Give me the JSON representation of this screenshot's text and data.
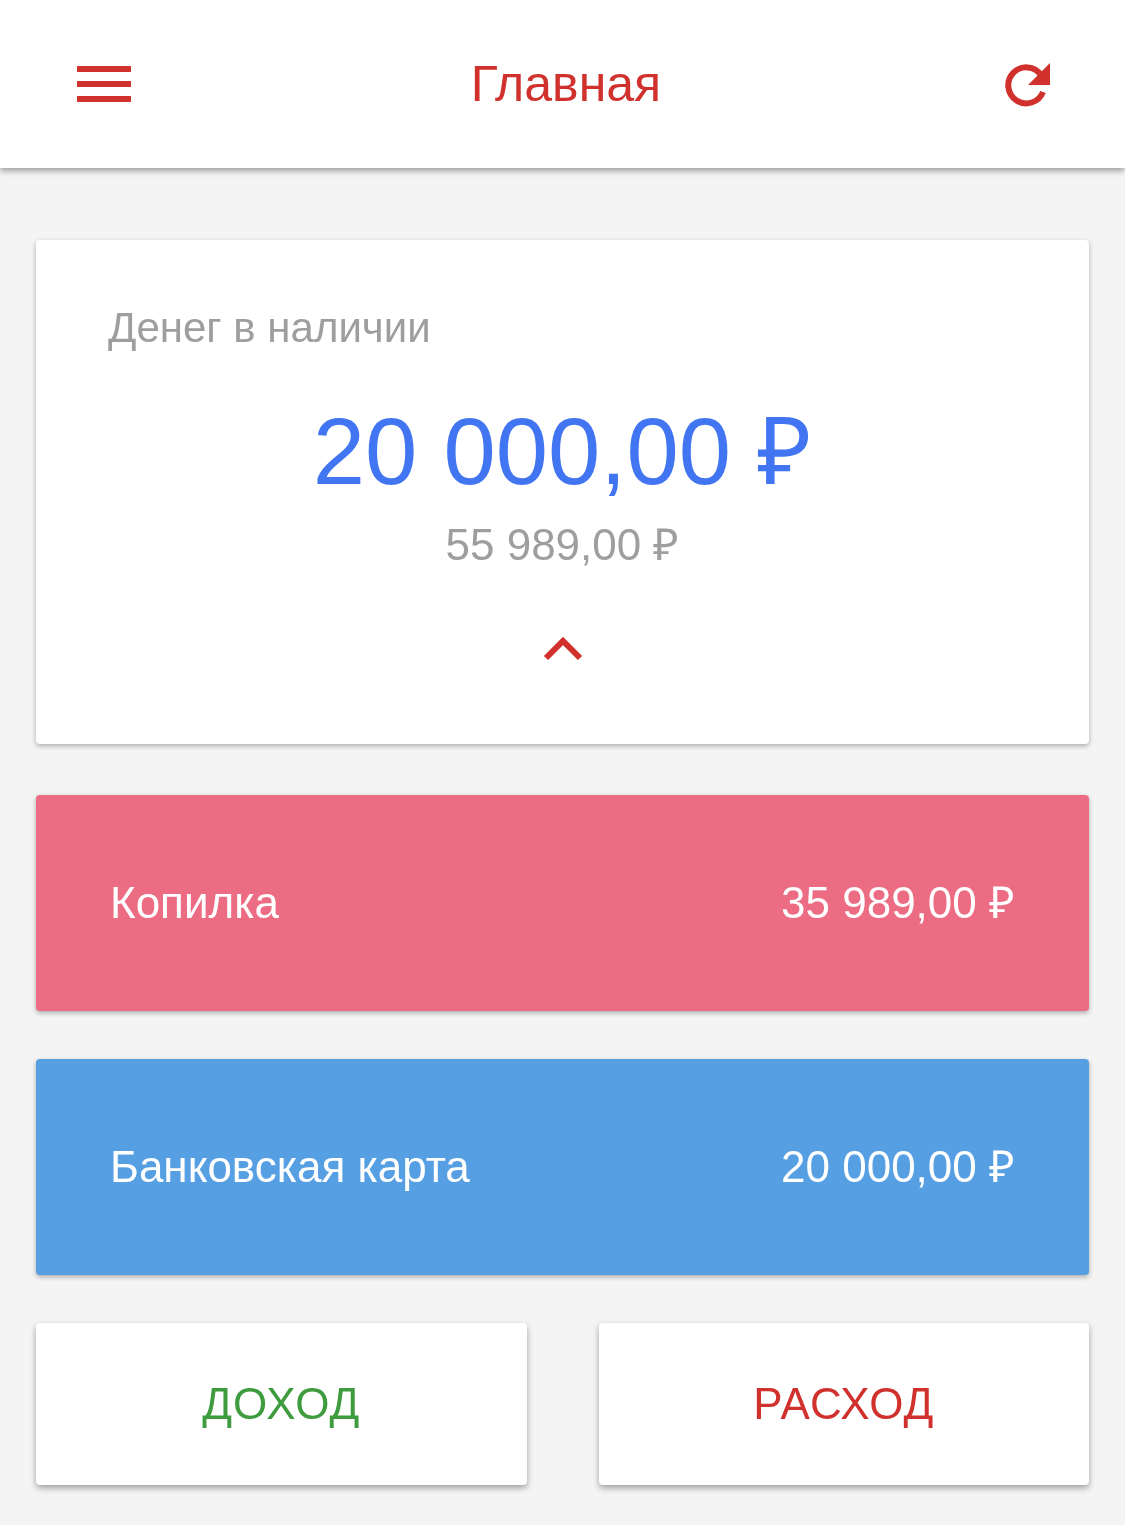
{
  "header": {
    "title": "Главная"
  },
  "balance_card": {
    "label": "Денег в наличии",
    "amount": "20 000,00 ₽",
    "total": "55 989,00 ₽",
    "expanded": true
  },
  "accounts": [
    {
      "name": "Копилка",
      "amount": "35 989,00 ₽",
      "color": "#ec6c83"
    },
    {
      "name": "Банковская карта",
      "amount": "20 000,00 ₽",
      "color": "#579fe3"
    }
  ],
  "actions": [
    {
      "label": "ДОХОД",
      "kind": "income"
    },
    {
      "label": "РАСХОД",
      "kind": "expense"
    }
  ]
}
